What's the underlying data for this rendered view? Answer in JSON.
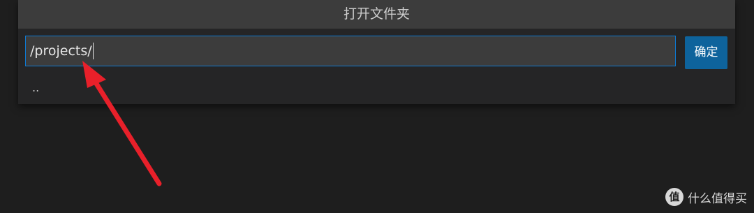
{
  "dialog": {
    "title": "打开文件夹",
    "path_value": "/projects/",
    "confirm_label": "确定",
    "list_items": [
      ".."
    ]
  },
  "annotation": {
    "arrow_color": "#e8202a"
  },
  "watermark": {
    "logo_glyph": "值",
    "text": "什么值得买"
  }
}
